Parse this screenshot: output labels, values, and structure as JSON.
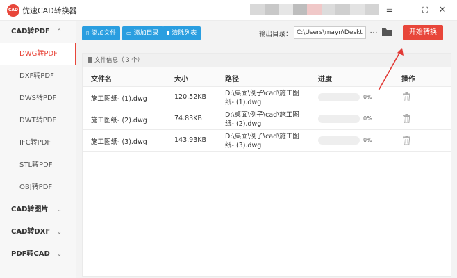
{
  "app": {
    "title": "优速CAD转换器",
    "logo_text": "CAD"
  },
  "window": {
    "menu_icon": "menu-icon",
    "minimize_icon": "minimize-icon",
    "maximize_icon": "maximize-icon",
    "close_icon": "close-icon"
  },
  "blur_colors": [
    "#d9d9d9",
    "#c8c8c8",
    "#e6e6e6",
    "#bdbdbd",
    "#f0c8c8",
    "#dcdcdc",
    "#cfcfcf",
    "#e3e3e3",
    "#d4d4d4"
  ],
  "sidebar": {
    "groups": [
      {
        "label": "CAD转PDF",
        "expanded": true,
        "items": [
          "DWG转PDF",
          "DXF转PDF",
          "DWS转PDF",
          "DWT转PDF",
          "IFC转PDF",
          "STL转PDF",
          "OBJ转PDF"
        ]
      },
      {
        "label": "CAD转图片",
        "expanded": false,
        "items": []
      },
      {
        "label": "CAD转DXF",
        "expanded": false,
        "items": []
      },
      {
        "label": "PDF转CAD",
        "expanded": false,
        "items": []
      }
    ],
    "active_item": "DWG转PDF",
    "expand_glyph": "⌃",
    "collapse_glyph": "⌄"
  },
  "toolbar": {
    "add_file": "添加文件",
    "add_dir": "添加目录",
    "clear_list": "清除列表",
    "output_label": "输出目录：",
    "output_path": "C:\\Users\\mayn\\Desktop",
    "more_label": "···",
    "start_label": "开始转换"
  },
  "panel": {
    "header_label": "文件信息（ 3 个）",
    "columns": {
      "name": "文件名",
      "size": "大小",
      "path": "路径",
      "progress": "进度",
      "action": "操作"
    },
    "rows": [
      {
        "name": "施工图纸- (1).dwg",
        "size": "120.52KB",
        "path_line1": "D:\\桌面\\例子\\cad\\施工图",
        "path_line2": "纸- (1).dwg",
        "progress": 0,
        "progress_text": "0%"
      },
      {
        "name": "施工图纸- (2).dwg",
        "size": "74.83KB",
        "path_line1": "D:\\桌面\\例子\\cad\\施工图",
        "path_line2": "纸- (2).dwg",
        "progress": 0,
        "progress_text": "0%"
      },
      {
        "name": "施工图纸- (3).dwg",
        "size": "143.93KB",
        "path_line1": "D:\\桌面\\例子\\cad\\施工图",
        "path_line2": "纸- (3).dwg",
        "progress": 0,
        "progress_text": "0%"
      }
    ]
  },
  "colors": {
    "accent_red": "#e8463a",
    "accent_blue": "#2a9ee0",
    "annotation_arrow": "#e23a36"
  }
}
